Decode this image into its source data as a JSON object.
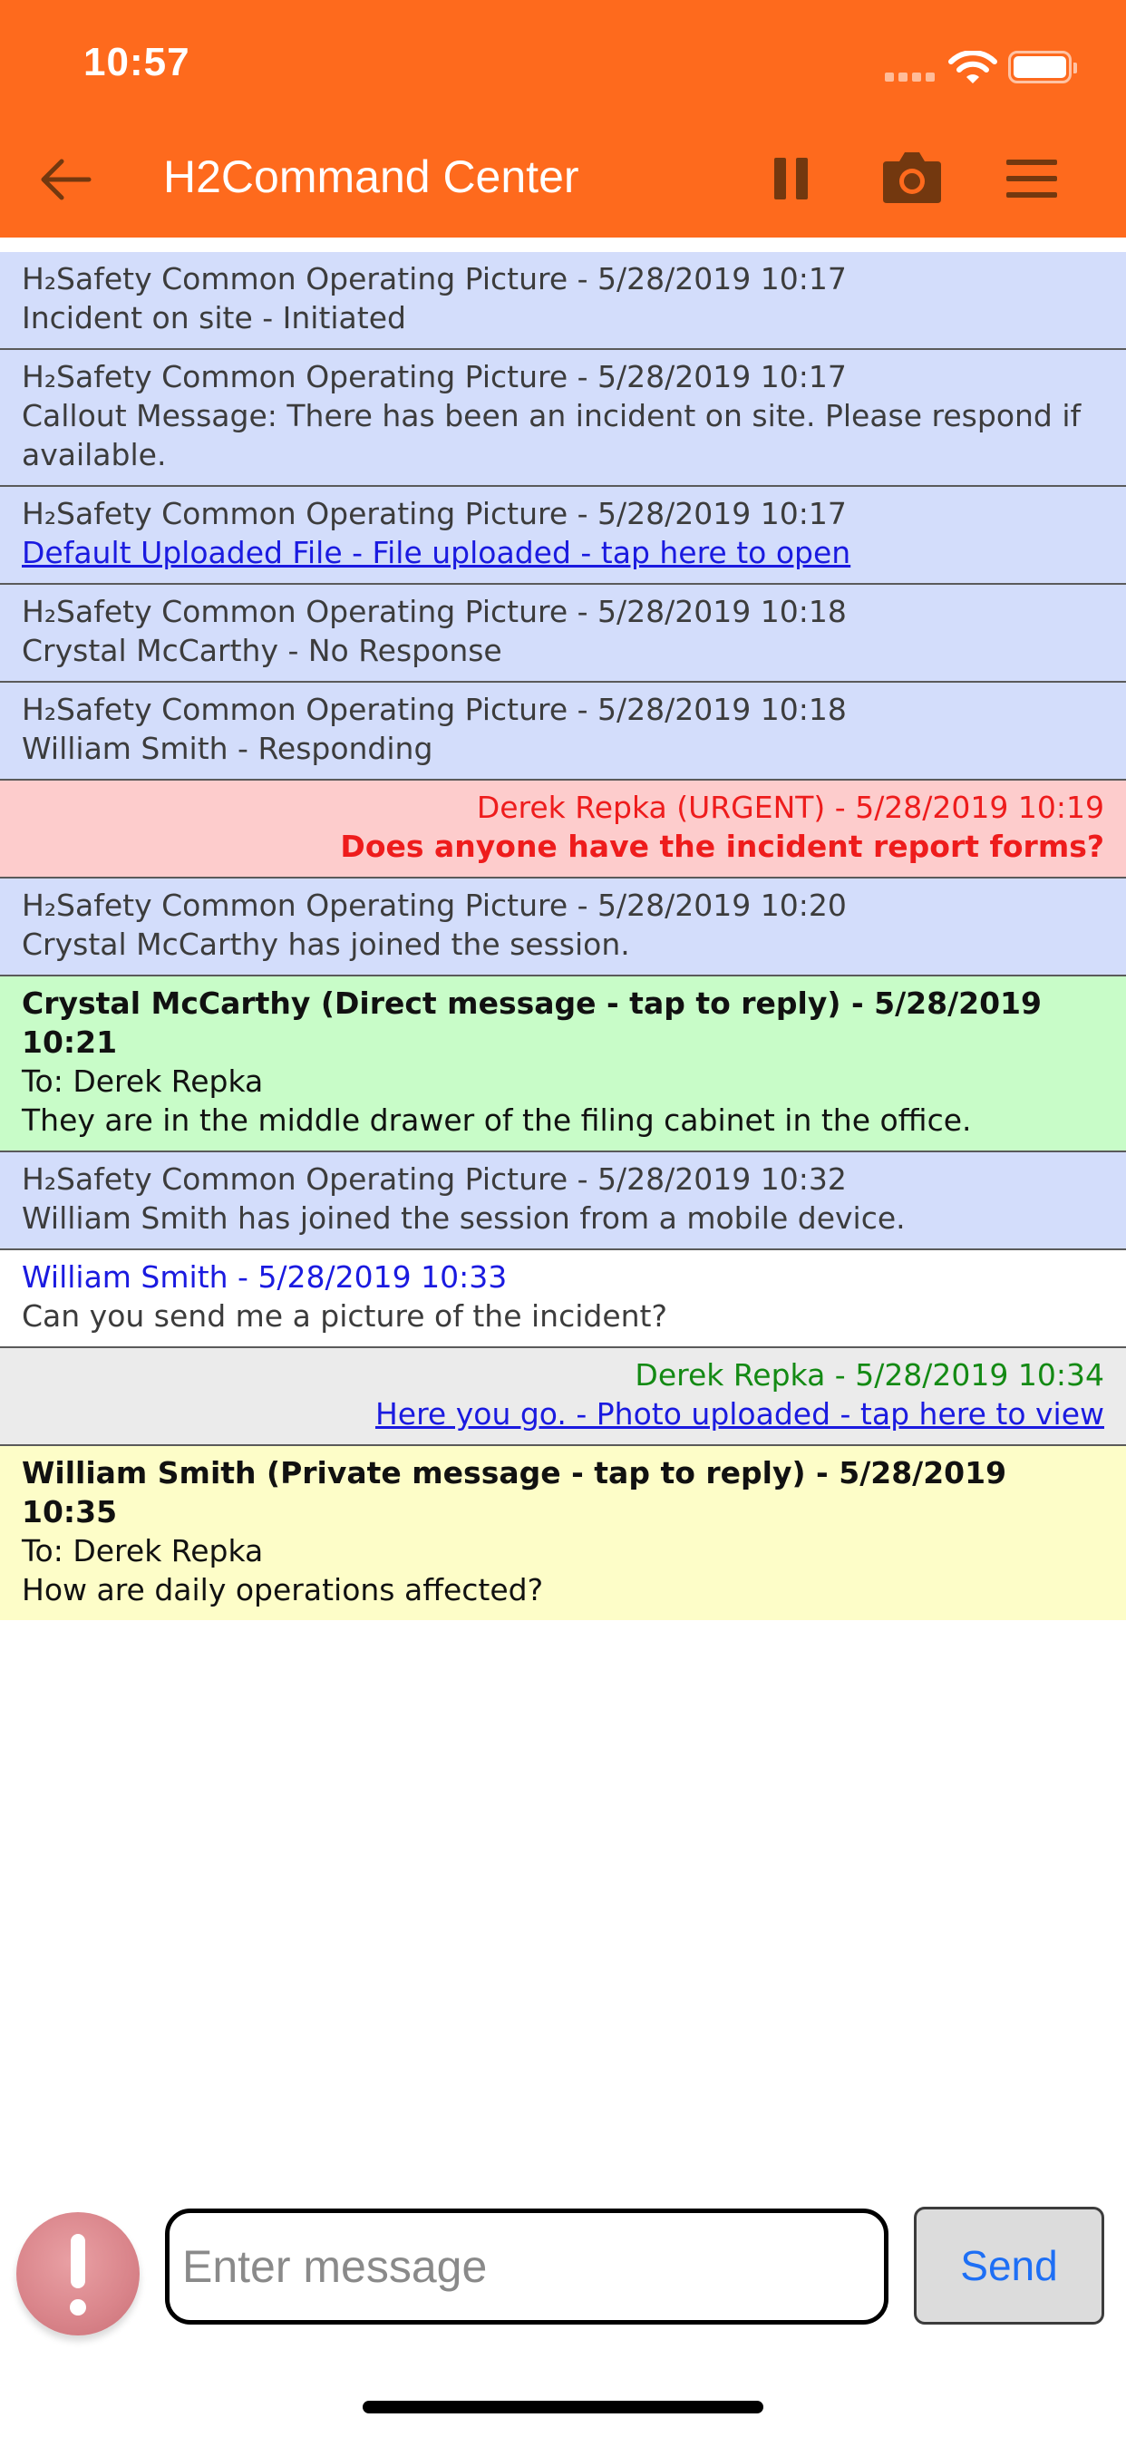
{
  "status_bar": {
    "time": "10:57"
  },
  "header": {
    "title": "H2Command Center"
  },
  "icons": {
    "back": "back-arrow-icon",
    "pause": "pause-icon",
    "camera": "camera-icon",
    "menu": "hamburger-menu-icon",
    "alert": "exclamation-alert-icon"
  },
  "colors": {
    "header_bg": "#fe6a1d",
    "system_bg": "#d3ddfb",
    "urgent_bg": "#fdcccc",
    "urgent_text": "#ee1c1c",
    "direct_bg": "#c8fcc8",
    "private_bg": "#fdfdc8",
    "sent_bg": "#ebebeb",
    "link": "#1a1ae0",
    "send_text": "#1e6ff5"
  },
  "messages": [
    {
      "type": "system",
      "header": "H₂Safety Common Operating Picture - 5/28/2019 10:17",
      "body": "Incident on site - Initiated"
    },
    {
      "type": "system",
      "header": "H₂Safety Common Operating Picture - 5/28/2019 10:17",
      "body": "Callout Message: There has been an incident on site. Please respond if available."
    },
    {
      "type": "system",
      "header": "H₂Safety Common Operating Picture - 5/28/2019 10:17",
      "body": "Default Uploaded File - File uploaded - tap here to open"
    },
    {
      "type": "system",
      "header": "H₂Safety Common Operating Picture - 5/28/2019 10:18",
      "body": "Crystal McCarthy - No Response"
    },
    {
      "type": "system",
      "header": "H₂Safety Common Operating Picture - 5/28/2019 10:18",
      "body": "William Smith - Responding"
    },
    {
      "type": "urgent",
      "header": "Derek Repka (URGENT) - 5/28/2019 10:19",
      "body": "Does anyone have the incident report forms?"
    },
    {
      "type": "system",
      "header": "H₂Safety Common Operating Picture - 5/28/2019 10:20",
      "body": "Crystal McCarthy has joined the session."
    },
    {
      "type": "direct",
      "header": "Crystal McCarthy (Direct message - tap to reply) - 5/28/2019 10:21",
      "to": "To: Derek Repka",
      "body": "They are in the middle drawer of the filing cabinet in the office."
    },
    {
      "type": "system",
      "header": "H₂Safety Common Operating Picture - 5/28/2019 10:32",
      "body": "William Smith has joined the session from a mobile device."
    },
    {
      "type": "plain",
      "header": "William Smith - 5/28/2019 10:33",
      "body": "Can you send me a picture of the incident?"
    },
    {
      "type": "sent",
      "header": "Derek Repka - 5/28/2019 10:34",
      "body": "Here you go. - Photo uploaded - tap here to view"
    },
    {
      "type": "private",
      "header": "William Smith (Private message - tap to reply) - 5/28/2019 10:35",
      "to": "To: Derek Repka",
      "body": "How are daily operations affected?"
    }
  ],
  "composer": {
    "placeholder": "Enter message",
    "value": "",
    "send_label": "Send"
  }
}
